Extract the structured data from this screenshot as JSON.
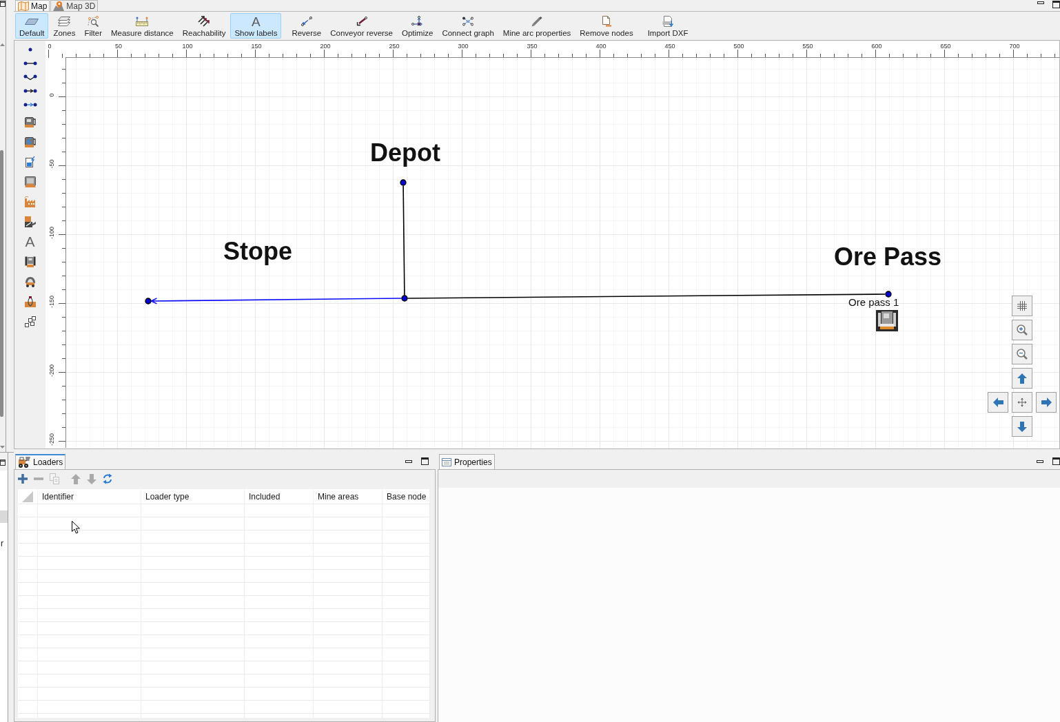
{
  "editor_tabs": [
    {
      "label": "Map",
      "selected": true
    },
    {
      "label": "Map 3D",
      "selected": false
    }
  ],
  "toolbar": [
    {
      "label": "Default",
      "selected": true
    },
    {
      "label": "Zones",
      "selected": false
    },
    {
      "label": "Filter",
      "selected": false
    },
    {
      "label": "Measure distance",
      "selected": false
    },
    {
      "label": "Reachability",
      "selected": false
    },
    {
      "label": "Show labels",
      "selected": true,
      "icon_text": "A"
    },
    {
      "label": "Reverse",
      "selected": false
    },
    {
      "label": "Conveyor reverse",
      "selected": false
    },
    {
      "label": "Optimize",
      "selected": false
    },
    {
      "label": "Connect graph",
      "selected": false
    },
    {
      "label": "Mine arc properties",
      "selected": false
    },
    {
      "label": "Remove nodes",
      "selected": false
    },
    {
      "label": "Import DXF",
      "selected": false
    }
  ],
  "map": {
    "tool_glyph": "A",
    "x_ruler": [
      "0",
      "50",
      "100",
      "150",
      "200",
      "250",
      "300",
      "350",
      "400",
      "450",
      "500",
      "550",
      "600",
      "650",
      "700"
    ],
    "y_ruler": [
      "0",
      "-50",
      "-100",
      "-150",
      "-200",
      "-250"
    ],
    "labels": [
      {
        "text": "Depot"
      },
      {
        "text": "Stope"
      },
      {
        "text": "Ore Pass"
      }
    ],
    "arcs": [
      {
        "selected": false,
        "directed": false
      },
      {
        "selected": true,
        "directed": true
      },
      {
        "selected": false,
        "directed": false
      }
    ],
    "node_caption": "Ore pass 1"
  },
  "loaders_panel": {
    "title": "Loaders",
    "focused": true,
    "tools": [
      {
        "kind": "add",
        "disabled": false
      },
      {
        "kind": "remove",
        "disabled": true
      },
      {
        "kind": "copy",
        "disabled": true
      },
      {
        "kind": "move_up",
        "disabled": true
      },
      {
        "kind": "move_down",
        "disabled": true
      },
      {
        "kind": "refresh",
        "disabled": false
      }
    ],
    "columns": [
      "Identifier",
      "Loader type",
      "Included",
      "Mine areas",
      "Base node"
    ]
  },
  "properties_panel": {
    "title": "Properties",
    "focused": false
  },
  "side_panel": {
    "text": "r"
  }
}
